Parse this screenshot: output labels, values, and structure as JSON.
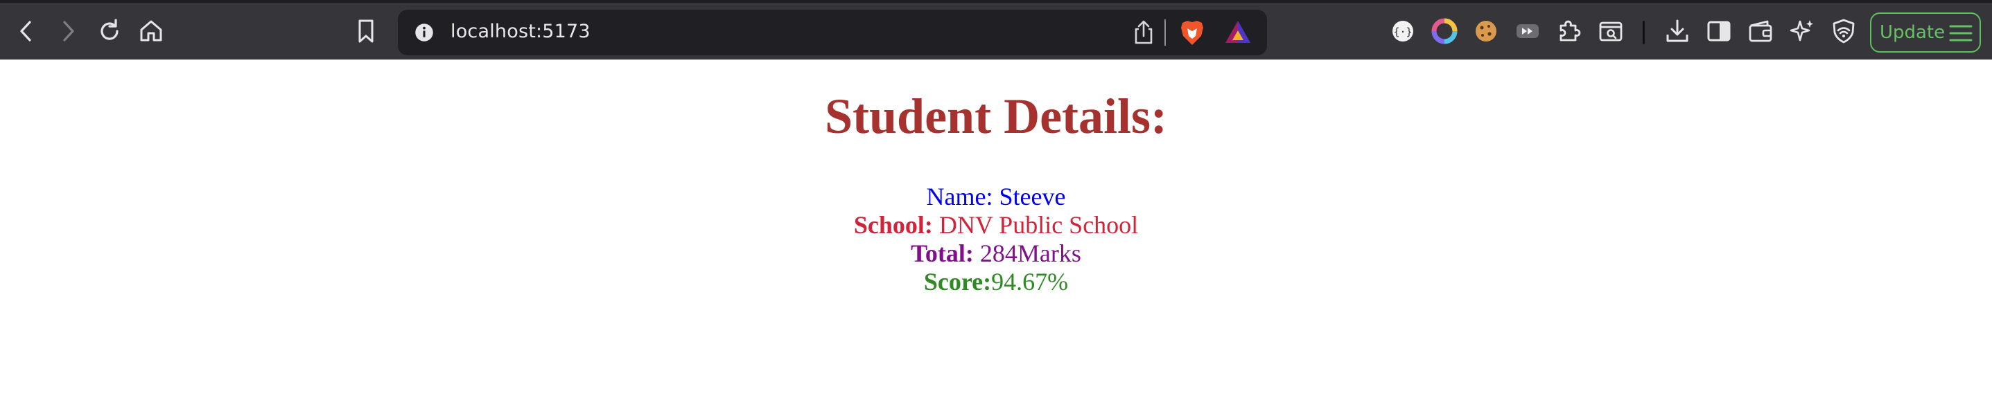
{
  "browser": {
    "url": "localhost:5173",
    "update_label": "Update",
    "colors": {
      "toolbar_bg": "#36353a",
      "omnibox_bg": "#202024",
      "update_green": "#67c267"
    },
    "icons": {
      "back": "chevron-left",
      "forward": "chevron-right",
      "reload": "reload",
      "home": "home",
      "bookmark": "bookmark",
      "site_info": "info-circle",
      "share": "share",
      "brave_shields": "brave-lion",
      "brave_rewards": "rewards-triangle",
      "extensions": [
        "json-viewer",
        "color-picker",
        "cookie",
        "media-forward",
        "puzzle",
        "reader"
      ],
      "right": [
        "download",
        "sidebar",
        "wallet",
        "leo-ai",
        "vpn-shield"
      ]
    }
  },
  "page": {
    "heading": "Student Details:",
    "name": {
      "label": "Name:",
      "value": " Steeve"
    },
    "school": {
      "label": "School:",
      "value": " DNV Public School"
    },
    "total": {
      "label": "Total:",
      "value": " 284Marks"
    },
    "score": {
      "label": "Score:",
      "value": "94.67%"
    },
    "colors": {
      "heading": "#a5322f",
      "name": "#0000ee",
      "school": "#d0243a",
      "total": "#80108a",
      "score": "#2f8a24"
    }
  }
}
